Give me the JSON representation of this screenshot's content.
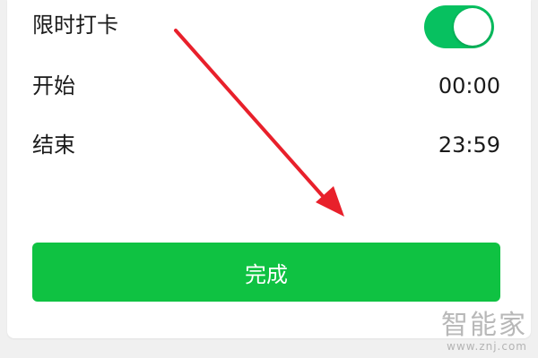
{
  "settings": {
    "rows": [
      {
        "label": "限时打卡",
        "type": "toggle",
        "on": true
      },
      {
        "label": "开始",
        "value": "00:00"
      },
      {
        "label": "结束",
        "value": "23:59"
      }
    ]
  },
  "actions": {
    "done_label": "完成"
  },
  "annotation": {
    "arrow_color": "#e8202b"
  },
  "watermark": {
    "main": "智能家",
    "sub": "www.znj.com"
  },
  "colors": {
    "accent": "#07c160",
    "button": "#0fc242"
  }
}
